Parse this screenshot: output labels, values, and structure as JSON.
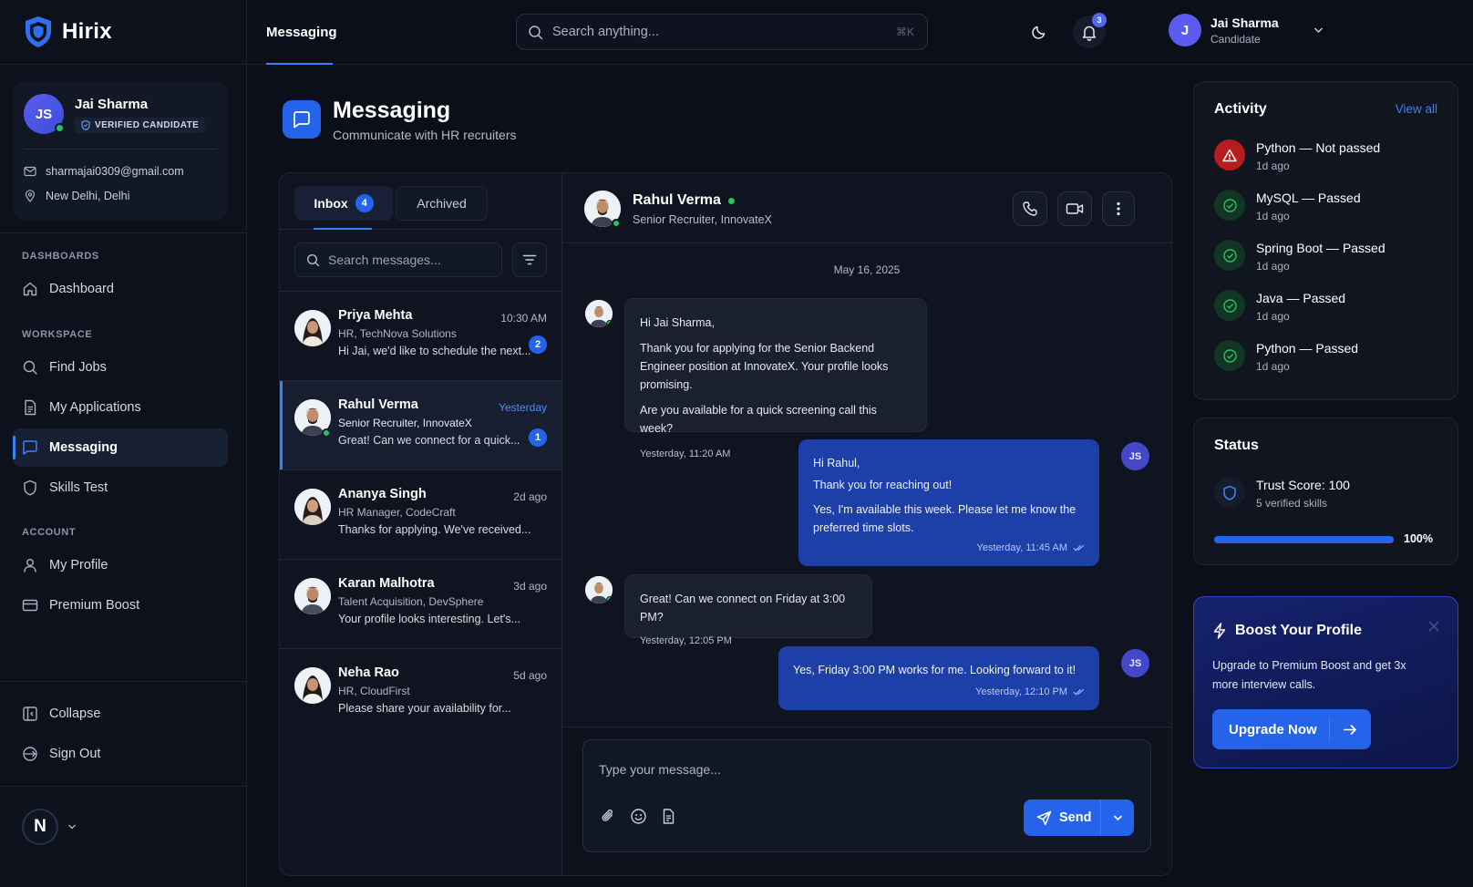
{
  "brand": {
    "name": "Hirix"
  },
  "topbar": {
    "title": "Messaging",
    "search_placeholder": "Search anything...",
    "search_shortcut": "⌘K",
    "notification_count": "3",
    "user": {
      "initial": "J",
      "name": "Jai Sharma",
      "role": "Candidate"
    }
  },
  "sidebar": {
    "profile": {
      "initials": "JS",
      "name": "Jai Sharma",
      "badge": "VERIFIED CANDIDATE",
      "email": "sharmajai0309@gmail.com",
      "location": "New Delhi, Delhi"
    },
    "sections": {
      "dashboards": "DASHBOARDS",
      "workspace": "WORKSPACE",
      "account": "ACCOUNT"
    },
    "items": {
      "dashboard": "Dashboard",
      "find_jobs": "Find Jobs",
      "my_applications": "My Applications",
      "messaging": "Messaging",
      "skills_test": "Skills Test",
      "my_profile": "My Profile",
      "premium_boost": "Premium Boost",
      "collapse": "Collapse",
      "sign_out": "Sign Out"
    },
    "footer_avatar": "N"
  },
  "page": {
    "title": "Messaging",
    "subtitle": "Communicate with HR recruiters"
  },
  "inbox": {
    "tabs": [
      {
        "label": "Inbox",
        "count": "4"
      },
      {
        "label": "Archived"
      }
    ],
    "search_placeholder": "Search messages...",
    "conversations": [
      {
        "name": "Priya Mehta",
        "role": "HR, TechNova Solutions",
        "preview": "Hi Jai, we'd like to schedule the next...",
        "time": "10:30 AM",
        "unread": "2"
      },
      {
        "name": "Rahul Verma",
        "role": "Senior Recruiter, InnovateX",
        "preview": "Great! Can we connect for a quick...",
        "time": "Yesterday",
        "unread": "1"
      },
      {
        "name": "Ananya Singh",
        "role": "HR Manager, CodeCraft",
        "preview": "Thanks for applying. We've received...",
        "time": "2d ago"
      },
      {
        "name": "Karan Malhotra",
        "role": "Talent Acquisition, DevSphere",
        "preview": "Your profile looks interesting. Let's...",
        "time": "3d ago"
      },
      {
        "name": "Neha Rao",
        "role": "HR, CloudFirst",
        "preview": "Please share your availability for...",
        "time": "5d ago"
      }
    ]
  },
  "chat": {
    "contact": {
      "name": "Rahul Verma",
      "role": "Senior Recruiter, InnovateX"
    },
    "date": "May 16, 2025",
    "my_initials": "JS",
    "messages": [
      {
        "paragraphs": [
          "Hi Jai Sharma,",
          "Thank you for applying for the Senior Backend Engineer position at InnovateX. Your profile looks promising.",
          "Are you available for a quick screening call this week?"
        ],
        "time": "Yesterday, 11:20 AM"
      },
      {
        "paragraphs": [
          "Hi Rahul,",
          "Thank you for reaching out!",
          "Yes, I'm available this week. Please let me know the preferred time slots."
        ],
        "time": "Yesterday, 11:45 AM"
      },
      {
        "paragraphs": [
          "Great! Can we connect on Friday at 3:00 PM?"
        ],
        "time": "Yesterday, 12:05 PM"
      },
      {
        "paragraphs": [
          "Yes, Friday 3:00 PM works for me. Looking forward to it!"
        ],
        "time": "Yesterday, 12:10 PM"
      }
    ],
    "compose_placeholder": "Type your message...",
    "send_label": "Send"
  },
  "activity": {
    "title": "Activity",
    "view_all": "View all",
    "items": [
      {
        "title": "Python — Not passed",
        "time": "1d ago",
        "status": "fail"
      },
      {
        "title": "MySQL — Passed",
        "time": "1d ago",
        "status": "pass"
      },
      {
        "title": "Spring Boot — Passed",
        "time": "1d ago",
        "status": "pass"
      },
      {
        "title": "Java — Passed",
        "time": "1d ago",
        "status": "pass"
      },
      {
        "title": "Python — Passed",
        "time": "1d ago",
        "status": "pass"
      }
    ]
  },
  "status": {
    "title": "Status",
    "trust_score": "Trust Score: 100",
    "verified_skills": "5 verified skills",
    "progress_percent": 100,
    "progress_label": "100%"
  },
  "boost": {
    "title": "Boost Your Profile",
    "text": "Upgrade to Premium Boost and get 3x more interview calls.",
    "button": "Upgrade Now"
  },
  "colors": {
    "accent": "#2563eb",
    "online": "#22c55e",
    "fail": "#dc2626",
    "pass": "#22c55e"
  }
}
